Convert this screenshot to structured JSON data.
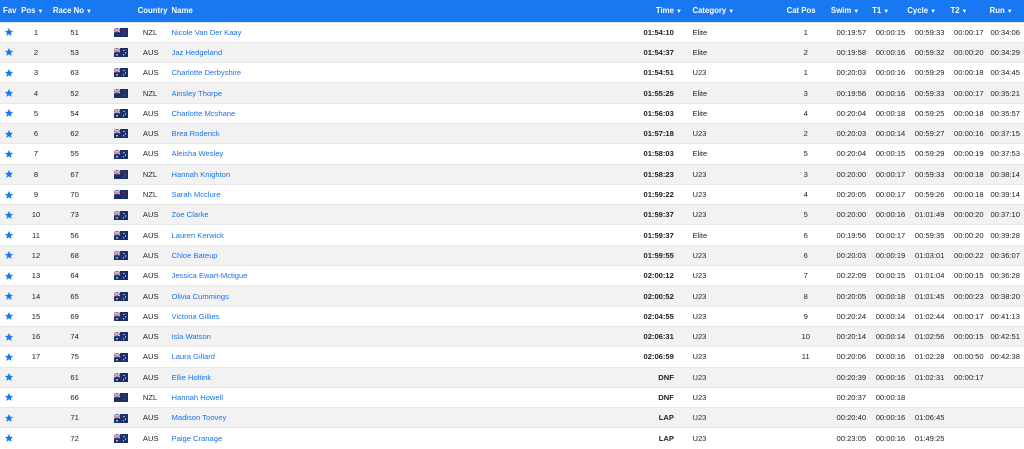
{
  "colors": {
    "header": "#1778f2",
    "link": "#1a73e8",
    "star": "#1778f2"
  },
  "columns": {
    "fav": "Fav",
    "pos": "Pos",
    "race_no": "Race No",
    "country": "Country",
    "name": "Name",
    "time": "Time",
    "category": "Category",
    "cat_pos": "Cat Pos",
    "swim": "Swim",
    "t1": "T1",
    "cycle": "Cycle",
    "t2": "T2",
    "run": "Run"
  },
  "sortable": [
    "pos",
    "race_no",
    "time",
    "category",
    "swim",
    "t1",
    "cycle",
    "t2",
    "run"
  ],
  "rows": [
    {
      "pos": "1",
      "race_no": "51",
      "country": "NZL",
      "name": "Nicole Van Der Kaay",
      "time": "01:54:10",
      "category": "Elite",
      "cat_pos": "1",
      "swim": "00:19:57",
      "t1": "00:00:15",
      "cycle": "00:59:33",
      "t2": "00:00:17",
      "run": "00:34:06"
    },
    {
      "pos": "2",
      "race_no": "53",
      "country": "AUS",
      "name": "Jaz Hedgeland",
      "time": "01:54:37",
      "category": "Elite",
      "cat_pos": "2",
      "swim": "00:19:58",
      "t1": "00:00:16",
      "cycle": "00:59:32",
      "t2": "00:00:20",
      "run": "00:34:29"
    },
    {
      "pos": "3",
      "race_no": "63",
      "country": "AUS",
      "name": "Charlotte Derbyshire",
      "time": "01:54:51",
      "category": "U23",
      "cat_pos": "1",
      "swim": "00:20:03",
      "t1": "00:00:16",
      "cycle": "00:59:29",
      "t2": "00:00:18",
      "run": "00:34:45"
    },
    {
      "pos": "4",
      "race_no": "52",
      "country": "NZL",
      "name": "Ainsley Thorpe",
      "time": "01:55:25",
      "category": "Elite",
      "cat_pos": "3",
      "swim": "00:19:56",
      "t1": "00:00:16",
      "cycle": "00:59:33",
      "t2": "00:00:17",
      "run": "00:35:21"
    },
    {
      "pos": "5",
      "race_no": "54",
      "country": "AUS",
      "name": "Charlotte Mcshane",
      "time": "01:56:03",
      "category": "Elite",
      "cat_pos": "4",
      "swim": "00:20:04",
      "t1": "00:00:18",
      "cycle": "00:59:25",
      "t2": "00:00:18",
      "run": "00:35:57"
    },
    {
      "pos": "6",
      "race_no": "62",
      "country": "AUS",
      "name": "Brea Roderick",
      "time": "01:57:18",
      "category": "U23",
      "cat_pos": "2",
      "swim": "00:20:03",
      "t1": "00:00:14",
      "cycle": "00:59:27",
      "t2": "00:00:16",
      "run": "00:37:15"
    },
    {
      "pos": "7",
      "race_no": "55",
      "country": "AUS",
      "name": "Aleisha Wesley",
      "time": "01:58:03",
      "category": "Elite",
      "cat_pos": "5",
      "swim": "00:20:04",
      "t1": "00:00:15",
      "cycle": "00:59:29",
      "t2": "00:00:19",
      "run": "00:37:53"
    },
    {
      "pos": "8",
      "race_no": "67",
      "country": "NZL",
      "name": "Hannah Knighton",
      "time": "01:58:23",
      "category": "U23",
      "cat_pos": "3",
      "swim": "00:20:00",
      "t1": "00:00:17",
      "cycle": "00:59:33",
      "t2": "00:00:18",
      "run": "00:38:14"
    },
    {
      "pos": "9",
      "race_no": "70",
      "country": "NZL",
      "name": "Sarah Mcclure",
      "time": "01:59:22",
      "category": "U23",
      "cat_pos": "4",
      "swim": "00:20:05",
      "t1": "00:00:17",
      "cycle": "00:59:26",
      "t2": "00:00:18",
      "run": "00:39:14"
    },
    {
      "pos": "10",
      "race_no": "73",
      "country": "AUS",
      "name": "Zoe Clarke",
      "time": "01:59:37",
      "category": "U23",
      "cat_pos": "5",
      "swim": "00:20:00",
      "t1": "00:00:16",
      "cycle": "01:01:49",
      "t2": "00:00:20",
      "run": "00:37:10"
    },
    {
      "pos": "11",
      "race_no": "56",
      "country": "AUS",
      "name": "Lauren Kerwick",
      "time": "01:59:37",
      "category": "Elite",
      "cat_pos": "6",
      "swim": "00:19:56",
      "t1": "00:00:17",
      "cycle": "00:59:35",
      "t2": "00:00:20",
      "run": "00:39:28"
    },
    {
      "pos": "12",
      "race_no": "68",
      "country": "AUS",
      "name": "Chloe Bateup",
      "time": "01:59:55",
      "category": "U23",
      "cat_pos": "6",
      "swim": "00:20:03",
      "t1": "00:00:19",
      "cycle": "01:03:01",
      "t2": "00:00:22",
      "run": "00:36:07"
    },
    {
      "pos": "13",
      "race_no": "64",
      "country": "AUS",
      "name": "Jessica Ewart-Mctigue",
      "time": "02:00:12",
      "category": "U23",
      "cat_pos": "7",
      "swim": "00:22:09",
      "t1": "00:00:15",
      "cycle": "01:01:04",
      "t2": "00:00:15",
      "run": "00:36:28"
    },
    {
      "pos": "14",
      "race_no": "65",
      "country": "AUS",
      "name": "Olivia Cummings",
      "time": "02:00:52",
      "category": "U23",
      "cat_pos": "8",
      "swim": "00:20:05",
      "t1": "00:00:18",
      "cycle": "01:01:45",
      "t2": "00:00:23",
      "run": "00:38:20"
    },
    {
      "pos": "15",
      "race_no": "69",
      "country": "AUS",
      "name": "Victoria Gillies",
      "time": "02:04:55",
      "category": "U23",
      "cat_pos": "9",
      "swim": "00:20:24",
      "t1": "00:00:14",
      "cycle": "01:02:44",
      "t2": "00:00:17",
      "run": "00:41:13"
    },
    {
      "pos": "16",
      "race_no": "74",
      "country": "AUS",
      "name": "Isla Watson",
      "time": "02:06:31",
      "category": "U23",
      "cat_pos": "10",
      "swim": "00:20:14",
      "t1": "00:00:14",
      "cycle": "01:02:56",
      "t2": "00:00:15",
      "run": "00:42:51"
    },
    {
      "pos": "17",
      "race_no": "75",
      "country": "AUS",
      "name": "Laura Gillard",
      "time": "02:06:59",
      "category": "U23",
      "cat_pos": "11",
      "swim": "00:20:06",
      "t1": "00:00:16",
      "cycle": "01:02:28",
      "t2": "00:00:50",
      "run": "00:42:38"
    },
    {
      "pos": "",
      "race_no": "61",
      "country": "AUS",
      "name": "Ellie Holtink",
      "time": "DNF",
      "category": "U23",
      "cat_pos": "",
      "swim": "00:20:39",
      "t1": "00:00:16",
      "cycle": "01:02:31",
      "t2": "00:00:17",
      "run": ""
    },
    {
      "pos": "",
      "race_no": "66",
      "country": "NZL",
      "name": "Hannah Howell",
      "time": "DNF",
      "category": "U23",
      "cat_pos": "",
      "swim": "00:20:37",
      "t1": "00:00:18",
      "cycle": "",
      "t2": "",
      "run": ""
    },
    {
      "pos": "",
      "race_no": "71",
      "country": "AUS",
      "name": "Madison Toovey",
      "time": "LAP",
      "category": "U23",
      "cat_pos": "",
      "swim": "00:20:40",
      "t1": "00:00:16",
      "cycle": "01:06:45",
      "t2": "",
      "run": ""
    },
    {
      "pos": "",
      "race_no": "72",
      "country": "AUS",
      "name": "Paige Cranage",
      "time": "LAP",
      "category": "U23",
      "cat_pos": "",
      "swim": "00:23:05",
      "t1": "00:00:16",
      "cycle": "01:49:25",
      "t2": "",
      "run": ""
    }
  ]
}
